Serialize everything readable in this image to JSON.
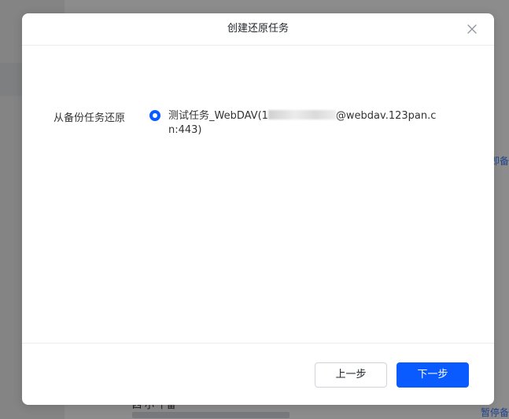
{
  "background": {
    "link_right_1": "即备",
    "link_right_2": "暂停备",
    "row_text": "四 小 十备"
  },
  "dialog": {
    "title": "创建还原任务",
    "close_icon": "close-icon",
    "field_label": "从备份任务还原",
    "option": {
      "selected": true,
      "text_prefix": "测试任务_WebDAV(1",
      "text_suffix": "@webdav.123pan.cn:443)"
    },
    "prev_label": "上一步",
    "next_label": "下一步"
  },
  "colors": {
    "accent": "#0a5bff",
    "overlay": "rgba(0,0,0,0.45)",
    "text": "#333333"
  }
}
